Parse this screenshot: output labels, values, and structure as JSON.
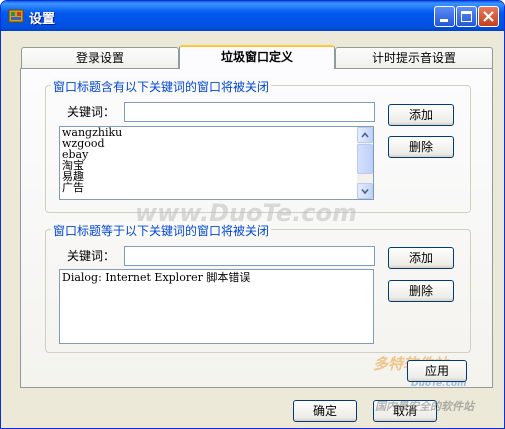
{
  "window": {
    "title": "设置"
  },
  "tabs": [
    {
      "label": "登录设置"
    },
    {
      "label": "垃圾窗口定义"
    },
    {
      "label": "计时提示音设置"
    }
  ],
  "group1": {
    "title": "窗口标题含有以下关键词的窗口将被关闭",
    "keyword_label": "关键词：",
    "keyword_value": "",
    "add_label": "添加",
    "delete_label": "删除",
    "items": [
      "wangzhiku",
      "wzgood",
      "ebay",
      "淘宝",
      "易趣",
      "广告"
    ]
  },
  "group2": {
    "title": "窗口标题等于以下关键词的窗口将被关闭",
    "keyword_label": "关键词：",
    "keyword_value": "",
    "add_label": "添加",
    "delete_label": "删除",
    "items": [
      "Dialog: Internet Explorer 脚本错误"
    ]
  },
  "buttons": {
    "apply": "应用",
    "ok": "确定",
    "cancel": "取消"
  },
  "watermarks": {
    "center": "www.DuoTe.com",
    "logo": "多特软件站",
    "logo_url": "DuoTe.com",
    "tagline": "国内最安全的软件站"
  },
  "colors": {
    "titlebar": "#0058ee",
    "group_title": "#0046d5",
    "tab_highlight": "#ffc83c",
    "dialog_bg": "#ece9d8"
  }
}
